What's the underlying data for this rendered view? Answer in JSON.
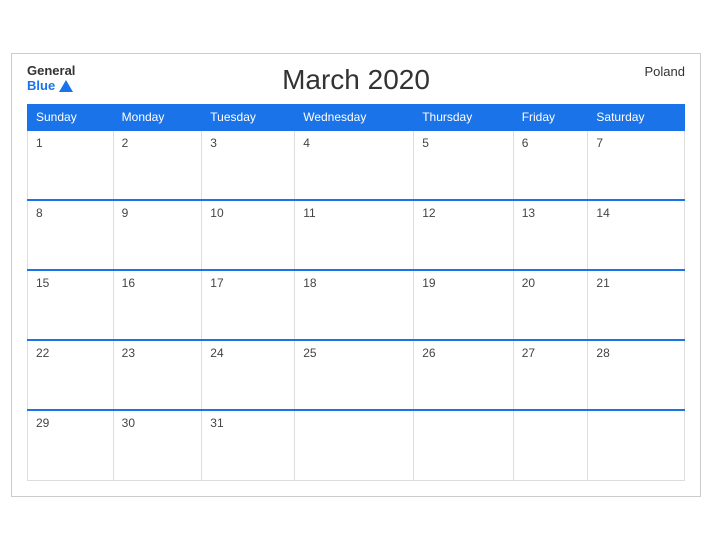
{
  "header": {
    "title": "March 2020",
    "country": "Poland",
    "logo_general": "General",
    "logo_blue": "Blue"
  },
  "weekdays": [
    "Sunday",
    "Monday",
    "Tuesday",
    "Wednesday",
    "Thursday",
    "Friday",
    "Saturday"
  ],
  "weeks": [
    [
      {
        "day": "1",
        "empty": false
      },
      {
        "day": "2",
        "empty": false
      },
      {
        "day": "3",
        "empty": false
      },
      {
        "day": "4",
        "empty": false
      },
      {
        "day": "5",
        "empty": false
      },
      {
        "day": "6",
        "empty": false
      },
      {
        "day": "7",
        "empty": false
      }
    ],
    [
      {
        "day": "8",
        "empty": false
      },
      {
        "day": "9",
        "empty": false
      },
      {
        "day": "10",
        "empty": false
      },
      {
        "day": "11",
        "empty": false
      },
      {
        "day": "12",
        "empty": false
      },
      {
        "day": "13",
        "empty": false
      },
      {
        "day": "14",
        "empty": false
      }
    ],
    [
      {
        "day": "15",
        "empty": false
      },
      {
        "day": "16",
        "empty": false
      },
      {
        "day": "17",
        "empty": false
      },
      {
        "day": "18",
        "empty": false
      },
      {
        "day": "19",
        "empty": false
      },
      {
        "day": "20",
        "empty": false
      },
      {
        "day": "21",
        "empty": false
      }
    ],
    [
      {
        "day": "22",
        "empty": false
      },
      {
        "day": "23",
        "empty": false
      },
      {
        "day": "24",
        "empty": false
      },
      {
        "day": "25",
        "empty": false
      },
      {
        "day": "26",
        "empty": false
      },
      {
        "day": "27",
        "empty": false
      },
      {
        "day": "28",
        "empty": false
      }
    ],
    [
      {
        "day": "29",
        "empty": false
      },
      {
        "day": "30",
        "empty": false
      },
      {
        "day": "31",
        "empty": false
      },
      {
        "day": "",
        "empty": true
      },
      {
        "day": "",
        "empty": true
      },
      {
        "day": "",
        "empty": true
      },
      {
        "day": "",
        "empty": true
      }
    ]
  ]
}
